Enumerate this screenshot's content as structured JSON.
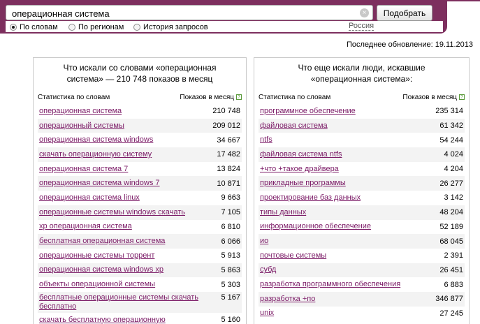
{
  "search": {
    "query": "операционная система",
    "submit_label": "Подобрать",
    "clear_label": "×"
  },
  "options": {
    "by_words": "По словам",
    "by_regions": "По регионам",
    "history": "История запросов",
    "region": "Россия",
    "selected": "by_words"
  },
  "last_update": "Последнее обновление: 19.11.2013",
  "left_panel": {
    "title": "Что искали со словами «операционная система» — 210 748 показов в месяц",
    "col_stats": "Статистика по словам",
    "col_shows": "Показов в месяц",
    "help": "?",
    "rows": [
      {
        "phrase": "операционная система",
        "count": "210 748"
      },
      {
        "phrase": "операционный системы",
        "count": "209 012"
      },
      {
        "phrase": "операционная система windows",
        "count": "34 667"
      },
      {
        "phrase": "скачать операционную систему",
        "count": "17 482"
      },
      {
        "phrase": "операционная система 7",
        "count": "13 824"
      },
      {
        "phrase": "операционная система windows 7",
        "count": "10 871"
      },
      {
        "phrase": "операционная система linux",
        "count": "9 663"
      },
      {
        "phrase": "операционные системы windows скачать",
        "count": "7 105"
      },
      {
        "phrase": "xp операционная система",
        "count": "6 810"
      },
      {
        "phrase": "бесплатная операционная система",
        "count": "6 066"
      },
      {
        "phrase": "операционные системы торрент",
        "count": "5 913"
      },
      {
        "phrase": "операционная система windows xp",
        "count": "5 863"
      },
      {
        "phrase": "объекты операционной системы",
        "count": "5 303"
      },
      {
        "phrase": "бесплатные операционные системы скачать бесплатно",
        "count": "5 167"
      },
      {
        "phrase": "скачать бесплатную операционную",
        "count": "5 160"
      }
    ]
  },
  "right_panel": {
    "title": "Что еще искали люди, искавшие «операционная система»:",
    "col_stats": "Статистика по словам",
    "col_shows": "Показов в месяц",
    "help": "?",
    "rows": [
      {
        "phrase": "программное обеспечение",
        "count": "235 314"
      },
      {
        "phrase": "файловая система",
        "count": "61 342"
      },
      {
        "phrase": "ntfs",
        "count": "54 244"
      },
      {
        "phrase": "файловая система ntfs",
        "count": "4 024"
      },
      {
        "phrase": "+что +такое драйвера",
        "count": "4 204"
      },
      {
        "phrase": "прикладные программы",
        "count": "26 277"
      },
      {
        "phrase": "проектирование баз данных",
        "count": "3 142"
      },
      {
        "phrase": "типы данных",
        "count": "48 204"
      },
      {
        "phrase": "информационное обеспечение",
        "count": "52 189"
      },
      {
        "phrase": "ио",
        "count": "68 045"
      },
      {
        "phrase": "почтовые системы",
        "count": "2 391"
      },
      {
        "phrase": "субд",
        "count": "26 451"
      },
      {
        "phrase": "разработка программного обеспечения",
        "count": "6 883"
      },
      {
        "phrase": "разработка +по",
        "count": "346 877"
      },
      {
        "phrase": "unix",
        "count": "27 245"
      }
    ]
  }
}
